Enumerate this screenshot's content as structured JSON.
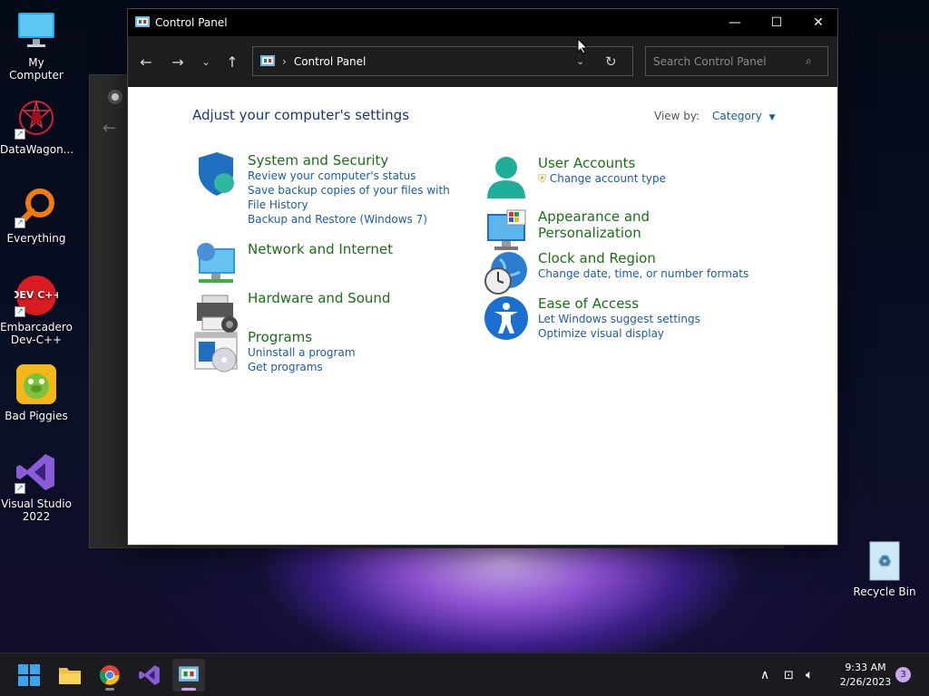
{
  "desktop": {
    "icons": [
      {
        "label": "My Computer"
      },
      {
        "label": "DataWagon..."
      },
      {
        "label": "Everything"
      },
      {
        "label": "Embarcadero Dev-C++"
      },
      {
        "label": "Bad Piggies"
      },
      {
        "label": "Visual Studio 2022"
      }
    ],
    "recycle_bin": "Recycle Bin",
    "devcpp_logo_text": "DEV C++"
  },
  "window": {
    "title": "Control Panel",
    "address_path": "Control Panel",
    "search_placeholder": "Search Control Panel"
  },
  "content": {
    "heading": "Adjust your computer's settings",
    "view_by_label": "View by:",
    "view_by_value": "Category",
    "categories_left": [
      {
        "title": "System and Security",
        "links": [
          "Review your computer's status",
          "Save backup copies of your files with File History",
          "Backup and Restore (Windows 7)"
        ]
      },
      {
        "title": "Network and Internet",
        "links": []
      },
      {
        "title": "Hardware and Sound",
        "links": []
      },
      {
        "title": "Programs",
        "links": [
          "Uninstall a program",
          "Get programs"
        ]
      }
    ],
    "categories_right": [
      {
        "title": "User Accounts",
        "links": [
          "Change account type"
        ]
      },
      {
        "title": "Appearance and Personalization",
        "links": []
      },
      {
        "title": "Clock and Region",
        "links": [
          "Change date, time, or number formats"
        ]
      },
      {
        "title": "Ease of Access",
        "links": [
          "Let Windows suggest settings",
          "Optimize visual display"
        ]
      }
    ]
  },
  "taskbar": {
    "time": "9:33 AM",
    "date": "2/26/2023",
    "notification_count": "3"
  },
  "colors": {
    "link": "#1a5bb0",
    "category_title": "#197017",
    "heading": "#1e3287",
    "accent_indicator": "#c9a6ef"
  }
}
